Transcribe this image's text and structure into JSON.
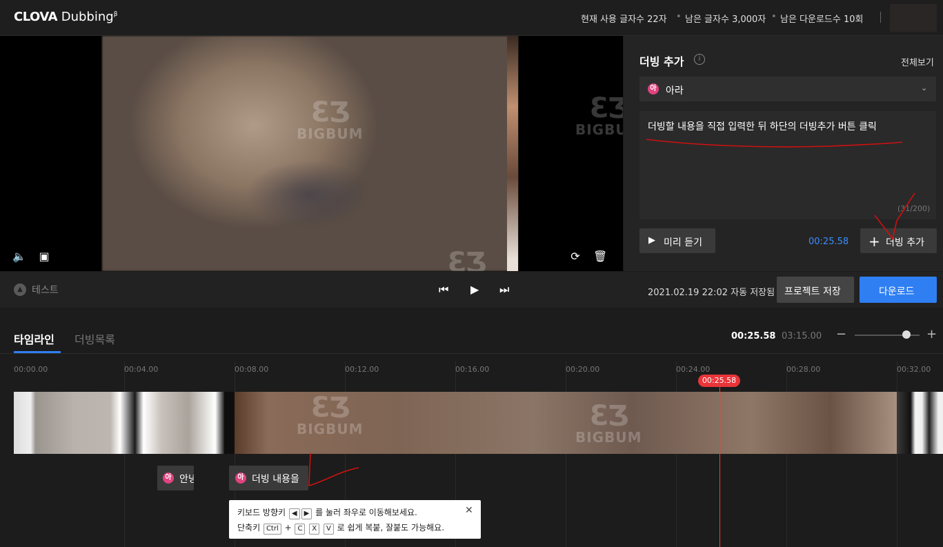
{
  "app": {
    "logo_text": "CLOVA",
    "logo_text2": "Dubbing",
    "logo_sup": "β"
  },
  "header": {
    "usage_current": "현재 사용 글자수 22자",
    "usage_remaining": "남은 글자수 3,000자",
    "downloads_remaining": "남은 다운로드수 10회",
    "dot": "•"
  },
  "watermark": {
    "mark": "ƐƷ",
    "text": "BIGBUM"
  },
  "video_controls": {
    "volume_icon": "🔈",
    "subtitle_icon": "▣",
    "replace_icon": "⟳",
    "delete_icon": "🗑"
  },
  "panel": {
    "title": "더빙 추가",
    "info_icon": "i",
    "view_all": "전체보기",
    "voice_badge": "아",
    "voice_name": "아라",
    "chevron": "⌄",
    "script_text": "더빙할 내용을 직접 입력한 뒤 하단의 더빙추가 버튼 클릭",
    "char_count": "(31/200)",
    "preview_icon": "▶",
    "preview_label": "미리 듣기",
    "dub_time": "00:25.58",
    "add_icon": "+",
    "add_label": "더빙 추가"
  },
  "midbar": {
    "toggle_icon": "▲",
    "project_name": "테스트",
    "prev_icon": "⏮",
    "play_icon": "▶",
    "next_icon": "⏭",
    "autosave": "2021.02.19 22:02 자동 저장됨",
    "save_label": "프로젝트 저장",
    "download_label": "다운로드"
  },
  "timeline": {
    "tab_timeline": "타임라인",
    "tab_list": "더빙목록",
    "current_time": "00:25.58",
    "total_time": "03:15.00",
    "zoom_minus": "−",
    "zoom_plus": "+",
    "zoom_level": 0.8,
    "ruler": [
      "00:00.00",
      "00:04.00",
      "00:08.00",
      "00:12.00",
      "00:16.00",
      "00:20.00",
      "00:24.00",
      "00:28.00",
      "00:32.00"
    ],
    "playhead": "00:25.58",
    "clips": [
      {
        "badge": "아",
        "label": "안녕"
      },
      {
        "badge": "아",
        "label": "더빙 내용을"
      }
    ]
  },
  "tooltip": {
    "line1_a": "키보드 방향키",
    "key_left": "◀",
    "key_right": "▶",
    "line1_b": "를 눌러 좌우로 이동해보세요.",
    "line2_a": "단축키",
    "key_ctrl": "Ctrl",
    "plus": "+",
    "key_c": "C",
    "key_x": "X",
    "key_v": "V",
    "line2_b": "로 쉽게 복붙, 잘붙도 가능해요.",
    "close": "✕"
  }
}
